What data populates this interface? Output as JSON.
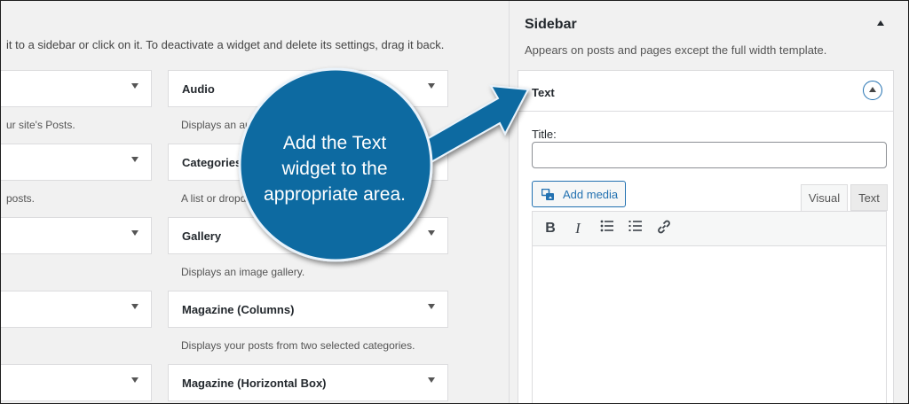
{
  "intro_text": "it to a sidebar or click on it. To deactivate a widget and delete its settings, drag it back.",
  "left_column": [
    {
      "title": "",
      "desc": "ur site's Posts."
    },
    {
      "title": "",
      "desc": "posts."
    },
    {
      "title": "",
      "desc": ""
    },
    {
      "title": "",
      "desc": ""
    },
    {
      "title": "",
      "desc": ""
    }
  ],
  "right_column": [
    {
      "title": "Audio",
      "desc": "Displays an au"
    },
    {
      "title": "Categories",
      "desc": "A list or dropd"
    },
    {
      "title": "Gallery",
      "desc": "Displays an image gallery."
    },
    {
      "title": "Magazine (Columns)",
      "desc": "Displays your posts from two selected categories."
    },
    {
      "title": "Magazine (Horizontal Box)",
      "desc": ""
    }
  ],
  "sidebar": {
    "title": "Sidebar",
    "description": "Appears on posts and pages except the full width template.",
    "text_widget": {
      "header": "Text",
      "title_label": "Title:",
      "title_value": "",
      "add_media_label": "Add media",
      "tabs": [
        "Visual",
        "Text"
      ],
      "toolbar_icons": [
        "bold-icon",
        "italic-icon",
        "bullet-list-icon",
        "numbered-list-icon",
        "link-icon"
      ]
    }
  },
  "callout": {
    "lines": [
      "Add the Text",
      "widget to the",
      "appropriate area."
    ],
    "color": "#0a6aa1"
  }
}
